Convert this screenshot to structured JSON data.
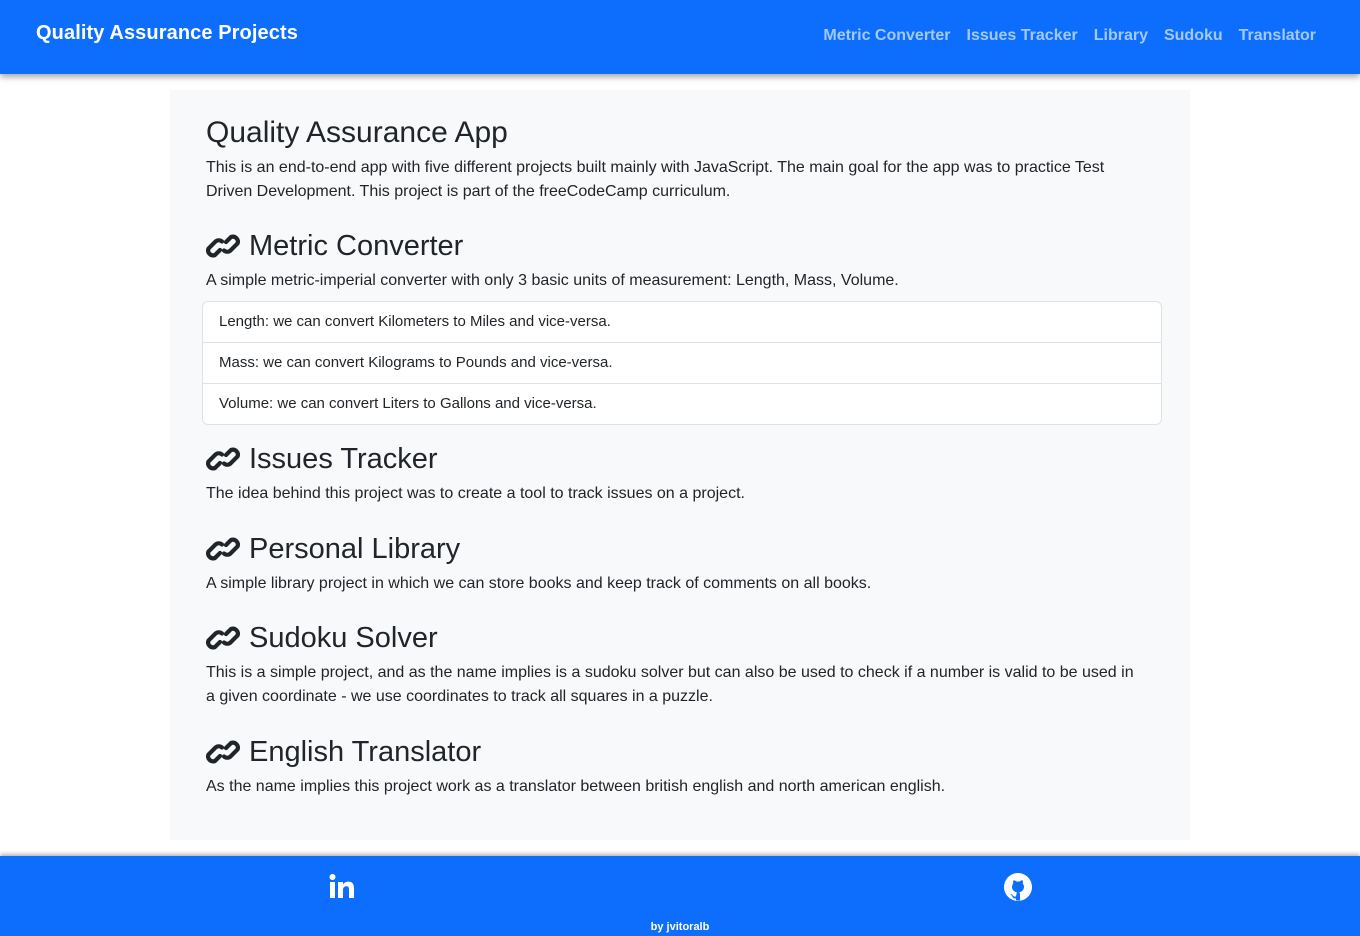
{
  "navbar": {
    "brand": "Quality Assurance Projects",
    "links": [
      "Metric Converter",
      "Issues Tracker",
      "Library",
      "Sudoku",
      "Translator"
    ]
  },
  "main": {
    "title": "Quality Assurance App",
    "intro": "This is an end-to-end app with five different projects built mainly with JavaScript. The main goal for the app was to practice Test Driven Development. This project is part of the freeCodeCamp curriculum.",
    "sections": [
      {
        "title": "Metric Converter",
        "description": "A simple metric-imperial converter with only 3 basic units of measurement: Length, Mass, Volume.",
        "items": [
          "Length: we can convert Kilometers to Miles and vice-versa.",
          "Mass: we can convert Kilograms to Pounds and vice-versa.",
          "Volume: we can convert Liters to Gallons and vice-versa."
        ]
      },
      {
        "title": "Issues Tracker",
        "description": "The idea behind this project was to create a tool to track issues on a project."
      },
      {
        "title": "Personal Library",
        "description": "A simple library project in which we can store books and keep track of comments on all books."
      },
      {
        "title": "Sudoku Solver",
        "description": "This is a simple project, and as the name implies is a sudoku solver but can also be used to check if a number is valid to be used in a given coordinate - we use coordinates to track all squares in a puzzle."
      },
      {
        "title": "English Translator",
        "description": "As the name implies this project work as a translator between british english and north american english."
      }
    ]
  },
  "footer": {
    "icons": [
      "linkedin-icon",
      "github-icon"
    ],
    "credit": "by jvitoralb"
  },
  "colors": {
    "primary": "#0d6efd",
    "panel": "#f8f9fa",
    "text": "#212529"
  }
}
